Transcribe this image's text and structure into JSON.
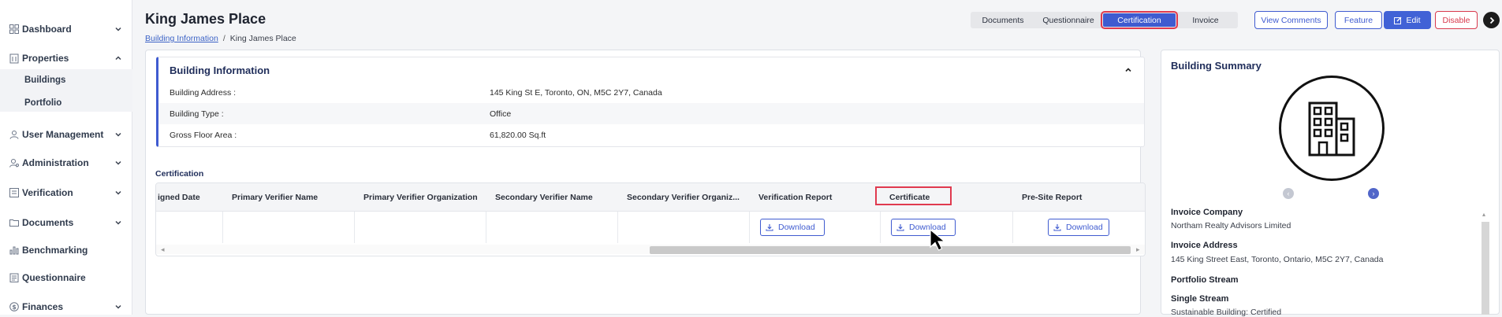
{
  "sidebar": {
    "items": [
      {
        "label": "Dashboard",
        "icon": "grid-icon",
        "chevron": "down"
      },
      {
        "label": "Properties",
        "icon": "building-icon",
        "chevron": "up"
      },
      {
        "label": "User Management",
        "icon": "user-icon",
        "chevron": "down"
      },
      {
        "label": "Administration",
        "icon": "admin-icon",
        "chevron": "down"
      },
      {
        "label": "Verification",
        "icon": "checklist-icon",
        "chevron": "down"
      },
      {
        "label": "Documents",
        "icon": "folder-icon",
        "chevron": "down"
      },
      {
        "label": "Benchmarking",
        "icon": "bar-chart-icon",
        "chevron": null
      },
      {
        "label": "Questionnaire",
        "icon": "clipboard-icon",
        "chevron": null
      },
      {
        "label": "Finances",
        "icon": "dollar-icon",
        "chevron": "down"
      }
    ],
    "sub_items": [
      "Buildings",
      "Portfolio"
    ]
  },
  "header": {
    "title": "King James Place",
    "breadcrumb": {
      "link": "Building Information",
      "separator": "/",
      "current": "King James Place"
    },
    "tabs": [
      "Documents",
      "Questionnaire",
      "Certification",
      "Invoice"
    ],
    "active_tab": "Certification",
    "buttons": {
      "view_comments": "View Comments",
      "feature": "Feature",
      "edit": "Edit",
      "disable": "Disable"
    }
  },
  "building_info": {
    "title": "Building Information",
    "rows": [
      {
        "key": "Building Address :",
        "value": "145 King St E, Toronto, ON, M5C 2Y7, Canada"
      },
      {
        "key": "Building Type :",
        "value": "Office"
      },
      {
        "key": "Gross Floor Area :",
        "value": "61,820.00 Sq.ft"
      }
    ]
  },
  "certification": {
    "label": "Certification",
    "columns": [
      "igned Date",
      "Primary Verifier Name",
      "Primary Verifier Organization",
      "Secondary Verifier Name",
      "Secondary Verifier Organiz...",
      "Verification Report",
      "Certificate",
      "Pre-Site Report"
    ],
    "download_label": "Download"
  },
  "summary": {
    "title": "Building Summary",
    "fields": [
      {
        "label": "Invoice Company",
        "value": "Northam Realty Advisors Limited"
      },
      {
        "label": "Invoice Address",
        "value": "145 King Street East, Toronto, Ontario, M5C 2Y7, Canada"
      },
      {
        "label": "Portfolio Stream",
        "value": ""
      },
      {
        "label": "Single Stream",
        "value": "Sustainable Building: Certified"
      }
    ]
  },
  "colors": {
    "accent": "#3f5bd0",
    "highlight": "#e03a4f",
    "danger": "#d9394c"
  }
}
